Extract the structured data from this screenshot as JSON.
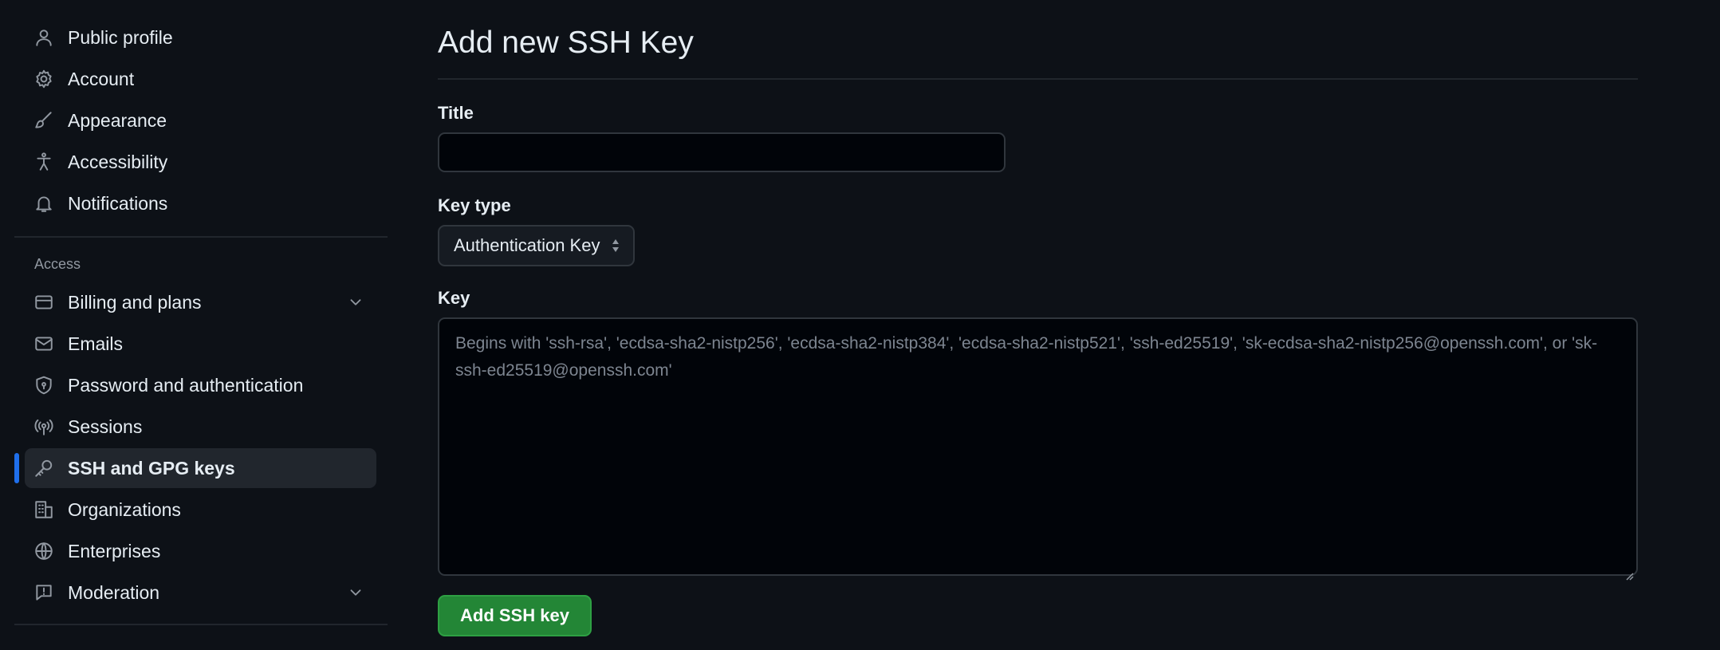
{
  "sidebar": {
    "top_items": [
      {
        "label": "Public profile",
        "icon": "person-icon"
      },
      {
        "label": "Account",
        "icon": "gear-icon"
      },
      {
        "label": "Appearance",
        "icon": "paintbrush-icon"
      },
      {
        "label": "Accessibility",
        "icon": "accessibility-icon"
      },
      {
        "label": "Notifications",
        "icon": "bell-icon"
      }
    ],
    "access_heading": "Access",
    "access_items": [
      {
        "label": "Billing and plans",
        "icon": "credit-card-icon",
        "expandable": true
      },
      {
        "label": "Emails",
        "icon": "mail-icon"
      },
      {
        "label": "Password and authentication",
        "icon": "shield-lock-icon"
      },
      {
        "label": "Sessions",
        "icon": "broadcast-icon"
      },
      {
        "label": "SSH and GPG keys",
        "icon": "key-icon",
        "active": true
      },
      {
        "label": "Organizations",
        "icon": "organization-icon"
      },
      {
        "label": "Enterprises",
        "icon": "globe-icon"
      },
      {
        "label": "Moderation",
        "icon": "report-icon",
        "expandable": true
      }
    ]
  },
  "main": {
    "title": "Add new SSH Key",
    "title_field": {
      "label": "Title",
      "value": ""
    },
    "key_type": {
      "label": "Key type",
      "selected": "Authentication Key"
    },
    "key_field": {
      "label": "Key",
      "placeholder": "Begins with 'ssh-rsa', 'ecdsa-sha2-nistp256', 'ecdsa-sha2-nistp384', 'ecdsa-sha2-nistp521', 'ssh-ed25519', 'sk-ecdsa-sha2-nistp256@openssh.com', or 'sk-ssh-ed25519@openssh.com'"
    },
    "submit_label": "Add SSH key"
  },
  "colors": {
    "background": "#0d1117",
    "active_indicator": "#1f6feb",
    "primary_button": "#238636"
  }
}
